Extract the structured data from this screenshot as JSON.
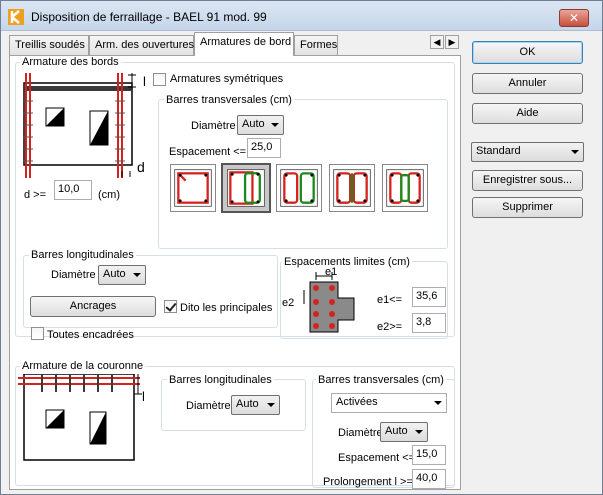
{
  "window": {
    "title": "Disposition de ferraillage - BAEL 91 mod. 99",
    "close_label": "✕"
  },
  "tabs": [
    {
      "label": "Treillis soudés",
      "active": false
    },
    {
      "label": "Arm. des ouvertures",
      "active": false
    },
    {
      "label": "Armatures de bord",
      "active": true
    },
    {
      "label": "Formes",
      "active": false
    }
  ],
  "tab_scroll": {
    "left": "◀",
    "right": "▶"
  },
  "edges": {
    "group_label": "Armature des bords",
    "symmetric_label": "Armatures symétriques",
    "symmetric_checked": false,
    "dim_l": "l",
    "dim_d": "d",
    "d_label": "d >=",
    "d_value": "10,0",
    "d_unit": "(cm)",
    "transverse": {
      "group_label": "Barres transversales (cm)",
      "diam_label": "Diamètre",
      "diam_value": "Auto",
      "spacing_label": "Espacement <=",
      "spacing_value": "25,0",
      "selected_section": 1
    },
    "longitudinal": {
      "group_label": "Barres longitudinales",
      "diam_label": "Diamètre",
      "diam_value": "Auto",
      "anchor_button": "Ancrages",
      "dito_label": "Dito les principales",
      "dito_checked": true,
      "all_framed_label": "Toutes encadrées",
      "all_framed_checked": false
    },
    "limits": {
      "group_label": "Espacements limites (cm)",
      "e1_top": "e1",
      "e2_side": "e2",
      "e1_label": "e1<=",
      "e1_value": "35,6",
      "e2_label": "e2>=",
      "e2_value": "3,8"
    }
  },
  "crown": {
    "group_label": "Armature de la couronne",
    "dim_l": "l",
    "longitudinal": {
      "group_label": "Barres longitudinales",
      "diam_label": "Diamètre",
      "diam_value": "Auto"
    },
    "transverse": {
      "group_label": "Barres transversales (cm)",
      "mode_value": "Activées",
      "diam_label": "Diamètre",
      "diam_value": "Auto",
      "spacing_label": "Espacement <=",
      "spacing_value": "15,0",
      "extension_label": "Prolongement l >=",
      "extension_value": "40,0"
    }
  },
  "side": {
    "ok": "OK",
    "cancel": "Annuler",
    "help": "Aide",
    "preset_value": "Standard",
    "save_as": "Enregistrer sous...",
    "delete": "Supprimer"
  },
  "colors": {
    "rebar_red": "#d4231f",
    "rebar_green": "#1b8a1b",
    "dark_bar": "#3a3a3a",
    "accent_default": "#3c7fb1"
  }
}
